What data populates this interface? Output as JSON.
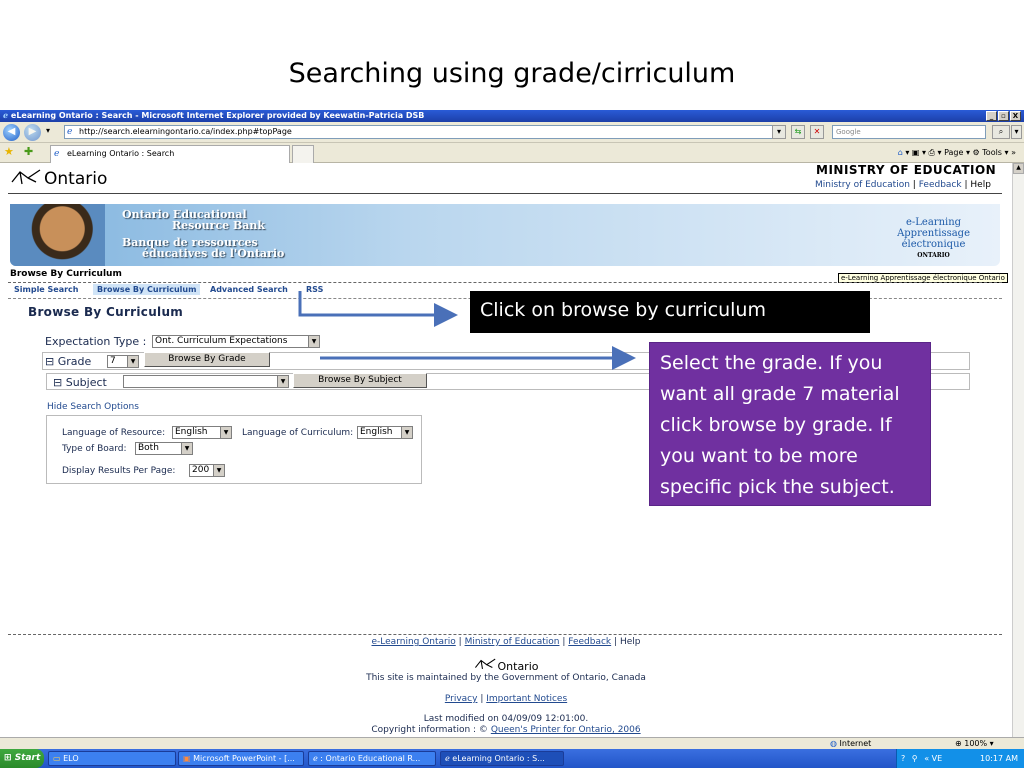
{
  "slide": {
    "title": "Searching using grade/cirriculum"
  },
  "window": {
    "title": "eLearning Ontario : Search - Microsoft Internet Explorer provided by Keewatin-Patricia DSB",
    "controls": {
      "minimize": "_",
      "restore": "▫",
      "close": "X"
    }
  },
  "address": {
    "url": "http://search.elearningontario.ca/index.php#topPage",
    "search_placeholder": "Google"
  },
  "favbar": {
    "tab_label": "eLearning Ontario : Search",
    "commands": "▾ ▣ ▾ ⎙ ▾ Page ▾ ⚙ Tools ▾",
    "page_label": "Page",
    "tools_label": "Tools"
  },
  "page": {
    "ministry": "MINISTRY OF EDUCATION",
    "toplinks": {
      "ministry": "Ministry of Education",
      "sep1": "|",
      "feedback": "Feedback",
      "sep2": "|",
      "help": "Help"
    },
    "logo_text": "Ontario",
    "banner": {
      "line1": "Ontario Educational",
      "line2": "Resource Bank",
      "line3": "Banque de ressources",
      "line4": "éducatives de l'Ontario",
      "elearn1": "e-Learning",
      "elearn2": "Apprentissage",
      "elearn3": "électronique",
      "elearn4": "ONTARIO"
    },
    "heading": "Browse By Curriculum",
    "tooltip": "e-Learning Apprentissage électronique Ontario",
    "tabs": [
      {
        "label": "Simple Search"
      },
      {
        "label": "Browse By Curriculum"
      },
      {
        "label": "Advanced Search"
      },
      {
        "label": "RSS"
      }
    ],
    "section_title": "Browse By Curriculum",
    "expectation_label": "Expectation Type",
    "expectation_colon": ":",
    "expectation_value": "Ont. Curriculum Expectations",
    "grade_toggle": "⊟",
    "grade_label": "Grade",
    "grade_value": "7",
    "browse_grade": "Browse By Grade",
    "subject_toggle": "⊟",
    "subject_label": "Subject",
    "subject_value": "",
    "browse_subject": "Browse By Subject",
    "hide_options": "Hide Search Options",
    "lang_resource_label": "Language of Resource:",
    "lang_resource_value": "English",
    "lang_curriculum_label": "Language of Curriculum:",
    "lang_curriculum_value": "English",
    "board_label": "Type of Board:",
    "board_value": "Both",
    "results_label": "Display Results Per Page:",
    "results_value": "200",
    "footer": {
      "elearning": "e-Learning Ontario",
      "ministry": "Ministry of Education",
      "feedback": "Feedback",
      "help": "Help",
      "sep": "|",
      "logo_text": "Ontario",
      "maintained": "This site is maintained by the Government of Ontario, Canada",
      "privacy": "Privacy",
      "notices": "Important Notices",
      "modified": "Last modified on 04/09/09 12:01:00.",
      "copyright": "Copyright information : ©",
      "printer": "Queen's Printer for Ontario, 2006"
    }
  },
  "status": {
    "zone": "Internet",
    "zoom": "100%"
  },
  "taskbar": {
    "start": "Start",
    "items": [
      {
        "label": "ELO"
      },
      {
        "label": "Microsoft PowerPoint - [..."
      },
      {
        "label": ": Ontario Educational R..."
      },
      {
        "label": "eLearning Ontario : S..."
      }
    ],
    "clock": "10:17 AM",
    "tray_text": "« VE"
  },
  "callouts": {
    "browse": "Click on browse by curriculum",
    "grade": "Select the grade.  If you want all grade 7 material click browse by grade. If you want to be more specific pick the subject."
  },
  "colors": {
    "callout_dark": "#000000",
    "callout_purple": "#7030a0",
    "arrow": "#4a70b8",
    "link": "#224a8f"
  }
}
